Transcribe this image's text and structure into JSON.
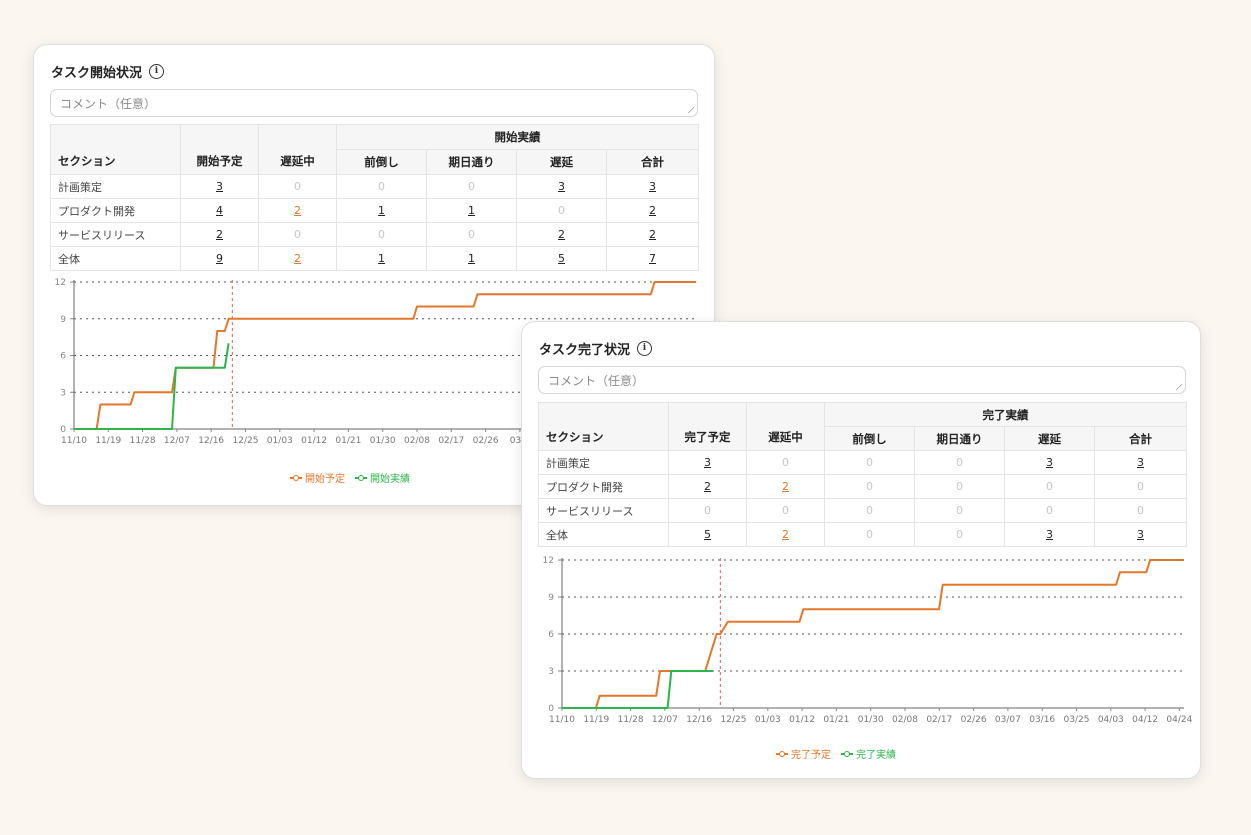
{
  "colors": {
    "planned": "#e5762a",
    "actual": "#2bb54a",
    "today_line": "#e85a5a",
    "grid": "#666666",
    "delay_number": "#e5762a"
  },
  "icons": {
    "info": "info-circle-icon"
  },
  "start_card": {
    "title": "タスク開始状況",
    "comment_placeholder": "コメント（任意）",
    "headers": {
      "section": "セクション",
      "planned": "開始予定",
      "delayed": "遅延中",
      "group": "開始実績",
      "early": "前倒し",
      "ontime": "期日通り",
      "late": "遅延",
      "total": "合計"
    },
    "rows": [
      {
        "section": "計画策定",
        "planned": "3",
        "delayed": "0",
        "early": "0",
        "ontime": "0",
        "late": "3",
        "total": "3"
      },
      {
        "section": "プロダクト開発",
        "planned": "4",
        "delayed": "2",
        "early": "1",
        "ontime": "1",
        "late": "0",
        "total": "2"
      },
      {
        "section": "サービスリリース",
        "planned": "2",
        "delayed": "0",
        "early": "0",
        "ontime": "0",
        "late": "2",
        "total": "2"
      },
      {
        "section": "全体",
        "planned": "9",
        "delayed": "2",
        "early": "1",
        "ontime": "1",
        "late": "5",
        "total": "7"
      }
    ],
    "legend": {
      "planned": "開始予定",
      "actual": "開始実績"
    }
  },
  "done_card": {
    "title": "タスク完了状況",
    "comment_placeholder": "コメント（任意）",
    "headers": {
      "section": "セクション",
      "planned": "完了予定",
      "delayed": "遅延中",
      "group": "完了実績",
      "early": "前倒し",
      "ontime": "期日通り",
      "late": "遅延",
      "total": "合計"
    },
    "rows": [
      {
        "section": "計画策定",
        "planned": "3",
        "delayed": "0",
        "early": "0",
        "ontime": "0",
        "late": "3",
        "total": "3"
      },
      {
        "section": "プロダクト開発",
        "planned": "2",
        "delayed": "2",
        "early": "0",
        "ontime": "0",
        "late": "0",
        "total": "0"
      },
      {
        "section": "サービスリリース",
        "planned": "0",
        "delayed": "0",
        "early": "0",
        "ontime": "0",
        "late": "0",
        "total": "0"
      },
      {
        "section": "全体",
        "planned": "5",
        "delayed": "2",
        "early": "0",
        "ontime": "0",
        "late": "3",
        "total": "3"
      }
    ],
    "legend": {
      "planned": "完了予定",
      "actual": "完了実績"
    }
  },
  "chart_data": [
    {
      "type": "line",
      "y_ticks": [
        "0",
        "3",
        "6",
        "9",
        "12"
      ],
      "ylim": [
        0,
        12
      ],
      "x_ticks": [
        "11/10",
        "11/19",
        "11/28",
        "12/07",
        "12/16",
        "12/25",
        "01/03",
        "01/12",
        "01/21",
        "01/30",
        "02/08",
        "02/17",
        "02/26",
        "03/0"
      ],
      "xlim": [
        "2024-11-10",
        "2025-04-24"
      ],
      "today": "2024-12-22",
      "grid": "dotted-horizontal",
      "legend_position": "bottom-center",
      "series": [
        {
          "name": "開始予定",
          "color": "#e5762a",
          "points": [
            [
              "2024-11-10",
              0
            ],
            [
              "2024-11-16",
              0
            ],
            [
              "2024-11-17",
              2
            ],
            [
              "2024-11-25",
              2
            ],
            [
              "2024-11-26",
              3
            ],
            [
              "2024-12-06",
              3
            ],
            [
              "2024-12-07",
              5
            ],
            [
              "2024-12-17",
              5
            ],
            [
              "2024-12-18",
              8
            ],
            [
              "2024-12-20",
              8
            ],
            [
              "2024-12-21",
              9
            ],
            [
              "2025-02-08",
              9
            ],
            [
              "2025-02-09",
              10
            ],
            [
              "2025-02-24",
              10
            ],
            [
              "2025-02-25",
              11
            ],
            [
              "2025-04-12",
              11
            ],
            [
              "2025-04-13",
              12
            ],
            [
              "2025-04-24",
              12
            ]
          ]
        },
        {
          "name": "開始実績",
          "color": "#2bb54a",
          "points": [
            [
              "2024-11-10",
              0
            ],
            [
              "2024-12-06",
              0
            ],
            [
              "2024-12-07",
              5
            ],
            [
              "2024-12-20",
              5
            ],
            [
              "2024-12-21",
              7
            ]
          ]
        }
      ]
    },
    {
      "type": "line",
      "y_ticks": [
        "0",
        "3",
        "6",
        "9",
        "12"
      ],
      "ylim": [
        0,
        12
      ],
      "x_ticks": [
        "11/10",
        "11/19",
        "11/28",
        "12/07",
        "12/16",
        "12/25",
        "01/03",
        "01/12",
        "01/21",
        "01/30",
        "02/08",
        "02/17",
        "02/26",
        "03/07",
        "03/16",
        "03/25",
        "04/03",
        "04/12",
        "04/24"
      ],
      "xlim": [
        "2024-11-10",
        "2025-04-24"
      ],
      "today": "2024-12-22",
      "grid": "dotted-horizontal",
      "legend_position": "bottom-center",
      "series": [
        {
          "name": "完了予定",
          "color": "#e5762a",
          "points": [
            [
              "2024-11-10",
              0
            ],
            [
              "2024-11-19",
              0
            ],
            [
              "2024-11-20",
              1
            ],
            [
              "2024-12-05",
              1
            ],
            [
              "2024-12-06",
              3
            ],
            [
              "2024-12-18",
              3
            ],
            [
              "2024-12-21",
              6
            ],
            [
              "2024-12-22",
              6
            ],
            [
              "2024-12-24",
              7
            ],
            [
              "2025-01-12",
              7
            ],
            [
              "2025-01-13",
              8
            ],
            [
              "2025-02-18",
              8
            ],
            [
              "2025-02-19",
              10
            ],
            [
              "2025-04-06",
              10
            ],
            [
              "2025-04-07",
              11
            ],
            [
              "2025-04-14",
              11
            ],
            [
              "2025-04-15",
              12
            ],
            [
              "2025-04-24",
              12
            ]
          ]
        },
        {
          "name": "完了実績",
          "color": "#2bb54a",
          "points": [
            [
              "2024-11-10",
              0
            ],
            [
              "2024-12-08",
              0
            ],
            [
              "2024-12-09",
              3
            ],
            [
              "2024-12-20",
              3
            ]
          ]
        }
      ]
    }
  ]
}
